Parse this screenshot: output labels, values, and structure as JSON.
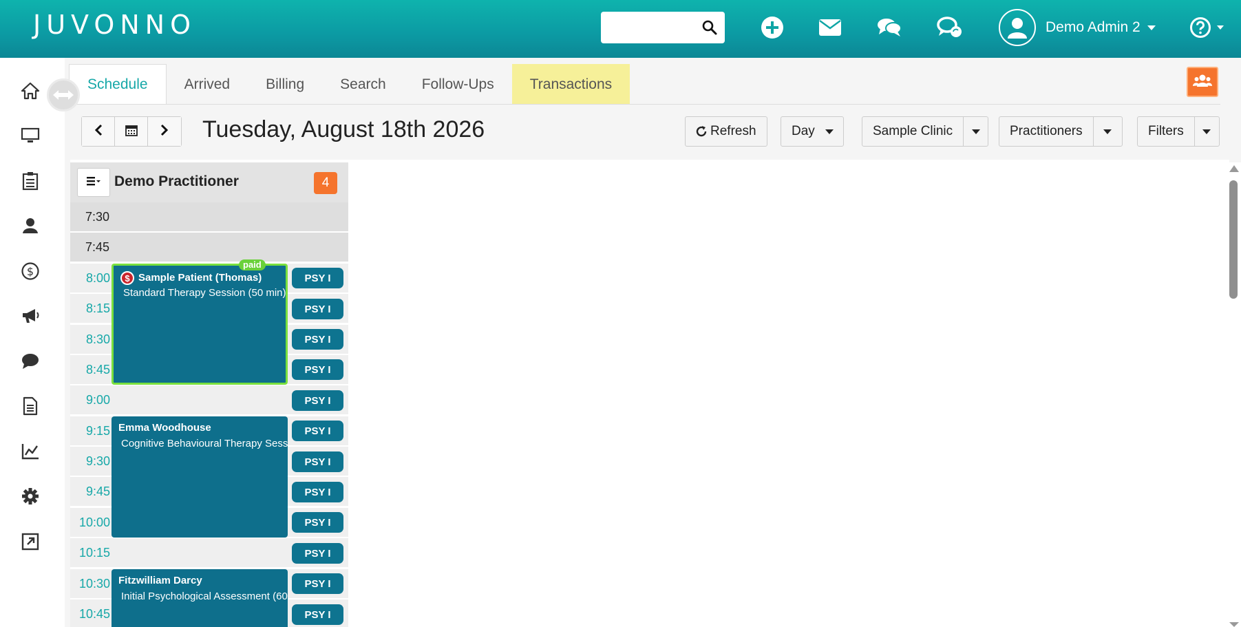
{
  "header": {
    "logo": "JUVONNO",
    "search_value": "",
    "user_name": "Demo Admin 2",
    "colors": {
      "teal": "#0eb3ad",
      "accent_orange": "#f5742d",
      "appointment": "#0e6f8c",
      "paid_green": "#6ad13a"
    }
  },
  "header_icons": [
    "plus-circle-icon",
    "envelope-icon",
    "chat-bubbles-icon",
    "chat-sync-icon",
    "help-icon"
  ],
  "sidebar_icons": [
    "home-icon",
    "monitor-icon",
    "clipboard-icon",
    "user-icon",
    "dollar-icon",
    "megaphone-icon",
    "speech-bubble-icon",
    "document-icon",
    "chart-icon",
    "gear-icon",
    "external-link-icon"
  ],
  "tabs": [
    {
      "label": "Schedule"
    },
    {
      "label": "Arrived"
    },
    {
      "label": "Billing"
    },
    {
      "label": "Search"
    },
    {
      "label": "Follow-Ups"
    },
    {
      "label": "Transactions"
    }
  ],
  "toolbar": {
    "date": "Tuesday, August 18th 2026",
    "refresh": "Refresh",
    "view": "Day",
    "clinic": "Sample Clinic",
    "practitioners": "Practitioners",
    "filters": "Filters"
  },
  "column": {
    "practitioner": "Demo Practitioner",
    "count": "4"
  },
  "slots": [
    {
      "time": "7:30"
    },
    {
      "time": "7:45"
    },
    {
      "time": "8:00",
      "psy": "PSY I"
    },
    {
      "time": "8:15",
      "psy": "PSY I"
    },
    {
      "time": "8:30",
      "psy": "PSY I"
    },
    {
      "time": "8:45",
      "psy": "PSY I"
    },
    {
      "time": "9:00",
      "psy": "PSY I"
    },
    {
      "time": "9:15",
      "psy": "PSY I"
    },
    {
      "time": "9:30",
      "psy": "PSY I"
    },
    {
      "time": "9:45",
      "psy": "PSY I"
    },
    {
      "time": "10:00",
      "psy": "PSY I"
    },
    {
      "time": "10:15",
      "psy": "PSY I"
    },
    {
      "time": "10:30",
      "psy": "PSY I"
    },
    {
      "time": "10:45",
      "psy": "PSY I"
    }
  ],
  "appointments": [
    {
      "patient": "Sample Patient (Thomas)",
      "service": "Standard Therapy Session (50 min)",
      "badge": "paid",
      "status_icon": "$"
    },
    {
      "patient": "Emma Woodhouse",
      "service": "Cognitive Behavioural Therapy Sess"
    },
    {
      "patient": "Fitzwilliam Darcy",
      "service": "Initial Psychological Assessment (60"
    }
  ]
}
